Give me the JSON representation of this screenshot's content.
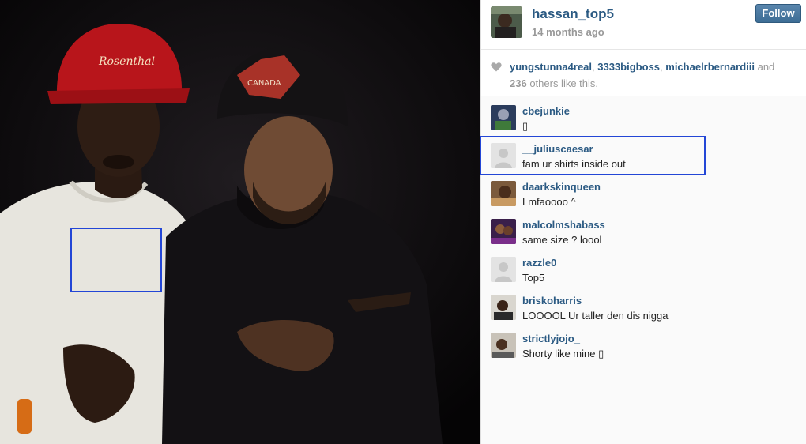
{
  "post": {
    "author": "hassan_top5",
    "timestamp": "14 months ago",
    "follow_label": "Follow"
  },
  "likes": {
    "users": [
      "yungstunna4real",
      "3333bigboss",
      "michaelrbernardiii"
    ],
    "sep1": ", ",
    "sep2": ", ",
    "and_text": " and ",
    "count": "236",
    "suffix": " others like this."
  },
  "comments": [
    {
      "username": "cbejunkie",
      "text": "",
      "avatar": "photo-avatar"
    },
    {
      "username": "__juliuscaesar",
      "text": "fam ur shirts inside out",
      "avatar": "default-avatar"
    },
    {
      "username": "daarkskinqueen",
      "text": "Lmfaoooo ^",
      "avatar": "photo-avatar"
    },
    {
      "username": "malcolmshabass",
      "text": "same size ? loool",
      "avatar": "photo-avatar"
    },
    {
      "username": "razzle0",
      "text": "Top5",
      "avatar": "default-avatar"
    },
    {
      "username": "briskoharris",
      "text": "LOOOOL Ur taller den dis nigga",
      "avatar": "photo-avatar"
    },
    {
      "username": "strictlyjojo_",
      "text": "Shorty like mine ",
      "avatar": "photo-avatar"
    }
  ],
  "colors": {
    "username": "#2b5a83",
    "muted": "#999999",
    "highlight": "#2346d6",
    "follow_button": "#3d6d95"
  }
}
